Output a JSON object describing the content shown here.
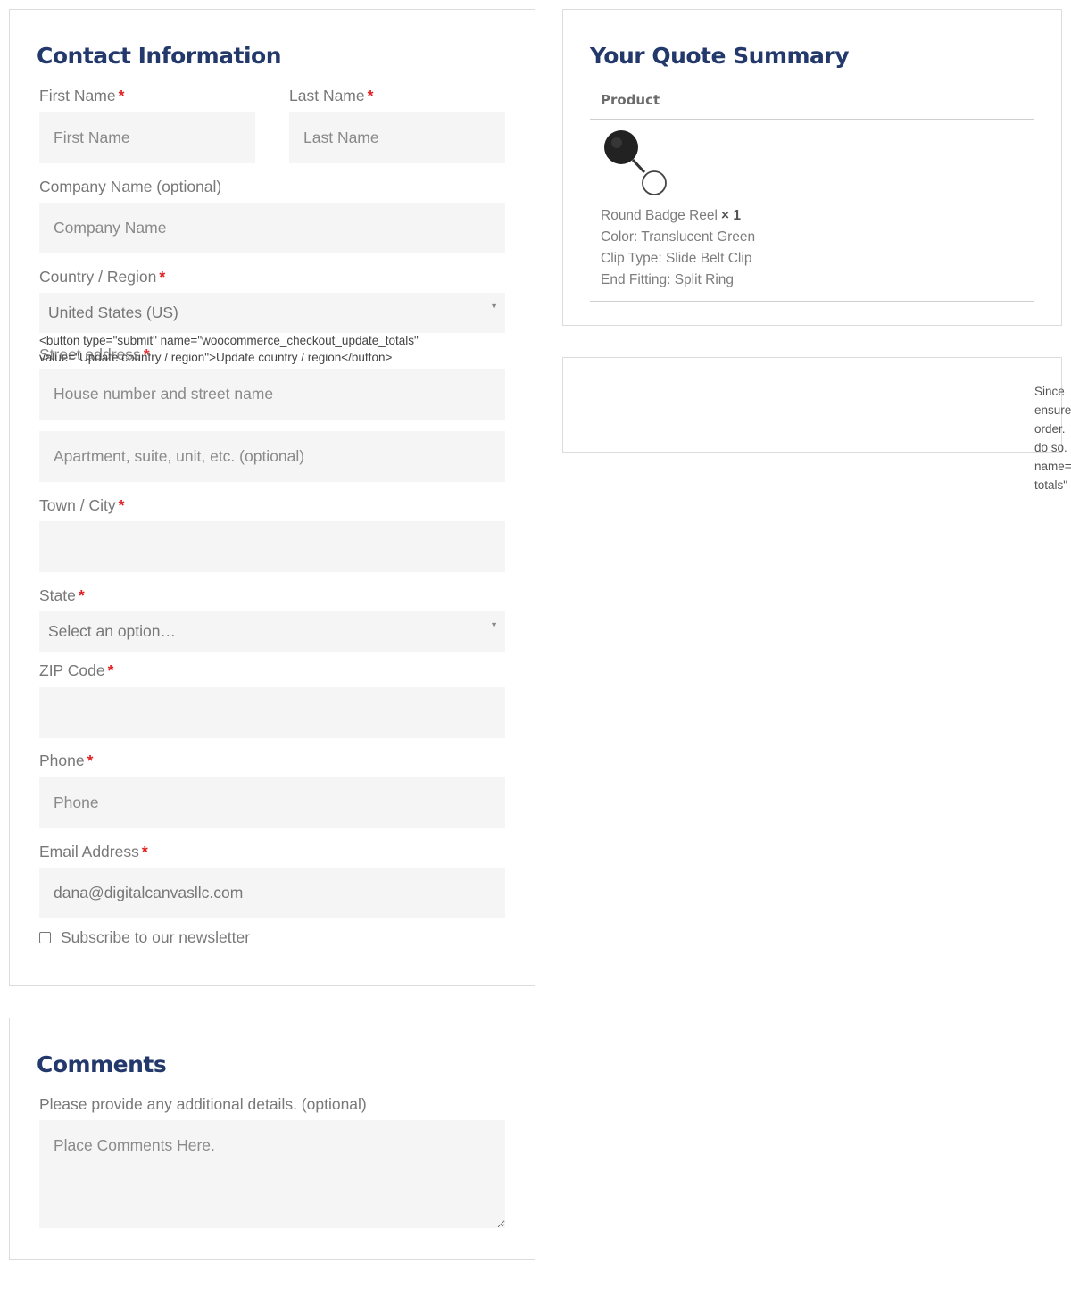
{
  "contact": {
    "title": "Contact Information",
    "first_name": {
      "label": "First Name",
      "required": "*",
      "placeholder": "First Name"
    },
    "last_name": {
      "label": "Last Name",
      "required": "*",
      "placeholder": "Last Name"
    },
    "company": {
      "label": "Company Name (optional)",
      "placeholder": "Company Name"
    },
    "country": {
      "label": "Country / Region",
      "required": "*",
      "value": "United States (US)"
    },
    "update_button_html": {
      "line1": "<button type=\"submit\" name=\"woocommerce_checkout_update_totals\"",
      "line2": "value=\"Update country / region\">Update country / region</button>"
    },
    "street": {
      "label": "Street address",
      "required": "*",
      "placeholder1": "House number and street name",
      "placeholder2": "Apartment, suite, unit, etc. (optional)"
    },
    "city": {
      "label": "Town / City",
      "required": "*",
      "value": ""
    },
    "state": {
      "label": "State",
      "required": "*",
      "value": "Select an option…"
    },
    "zip": {
      "label": "ZIP Code",
      "required": "*",
      "value": ""
    },
    "phone": {
      "label": "Phone",
      "required": "*",
      "placeholder": "Phone"
    },
    "email": {
      "label": "Email Address",
      "required": "*",
      "value": "dana@digitalcanvasllc.com"
    },
    "newsletter": {
      "label": "Subscribe to our newsletter",
      "checked": false
    }
  },
  "comments": {
    "title": "Comments",
    "label": "Please provide any additional details. (optional)",
    "placeholder": "Place Comments Here."
  },
  "summary": {
    "title": "Your Quote Summary",
    "column_header": "Product",
    "item": {
      "icon": "badge-reel-image",
      "name": "Round Badge Reel",
      "qty": "× 1",
      "color": "Color: Translucent Green",
      "clip": "Clip Type: Slide Belt Clip",
      "fitting": "End Fitting: Split Ring"
    }
  },
  "overflow_notice": {
    "lines": [
      "Since",
      "ensure",
      "order.",
      "do so.",
      "name=",
      "totals\""
    ]
  },
  "colors": {
    "heading": "#23386b",
    "required": "#e02020",
    "field_bg": "#f5f5f5"
  }
}
